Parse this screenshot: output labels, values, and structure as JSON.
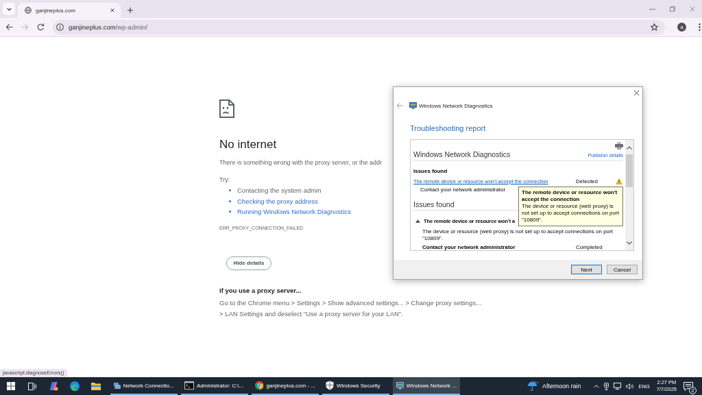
{
  "browser": {
    "tabs": [
      {
        "title": "ganjineplus.com",
        "selected": true
      }
    ],
    "nav": [
      {
        "kind": "back",
        "disabled": false
      },
      {
        "kind": "forward",
        "disabled": true
      },
      {
        "kind": "reload",
        "disabled": false
      }
    ],
    "address": {
      "host": "ganjineplus.com",
      "path": "/wp-admin/"
    },
    "profile_initial": "a"
  },
  "error_page": {
    "title": "No internet",
    "message": "There is something wrong with the proxy server, or the addr",
    "try_label": "Try:",
    "suggestions": [
      {
        "text": "Contacting the system admin",
        "kind": "text"
      },
      {
        "text": "Checking the proxy address",
        "kind": "link"
      },
      {
        "text": "Running Windows Network Diagnostics",
        "kind": "link"
      }
    ],
    "error_code": "ERR_PROXY_CONNECTION_FAILED",
    "details_button": "Hide details",
    "proxy_heading": "If you use a proxy server...",
    "proxy_help": "Go to the Chrome menu > Settings > Show advanced settings... > Change proxy settings... > LAN Settings and deselect \"Use a proxy server for your LAN\"."
  },
  "status_bubble": "javascript:diagnoseErrors()",
  "dialog": {
    "title": "Windows Network Diagnostics",
    "heading": "Troubleshooting report",
    "report": {
      "title": "Windows Network Diagnostics",
      "publisher_link": "Publisher details",
      "summary_heading": "Issues found",
      "summary": [
        {
          "issue": "The remote device or resource won't accept the connection",
          "status": "Detected",
          "action": "Contact your network administrator"
        }
      ],
      "details_heading": "Issues found",
      "details": [
        {
          "title": "The remote device or resource won't a",
          "expanded": true,
          "description": "The device or resource (web proxy) is not set up to accept connections on port \"10809\"."
        }
      ],
      "actions": [
        {
          "title": "Contact your network administrator",
          "status": "Completed"
        }
      ]
    },
    "tooltip": {
      "title": "The remote device or resource won't accept the connection",
      "text": "The device or resource (web proxy) is not set up to accept connections on port \"10809\"."
    },
    "buttons": [
      {
        "label": "Next",
        "default": true
      },
      {
        "label": "Cancel",
        "default": false
      }
    ]
  },
  "taskbar": {
    "apps": [
      {
        "kind": "network",
        "label": "Network Connectio...",
        "selected": false
      },
      {
        "kind": "terminal",
        "label": "Administrator: C:\\...",
        "selected": false
      },
      {
        "kind": "browser",
        "label": "ganjineplus.com - ...",
        "selected": false
      },
      {
        "kind": "security",
        "label": "Windows Security",
        "selected": false
      },
      {
        "kind": "diagnostics",
        "label": "Windows Network ...",
        "selected": true
      }
    ],
    "weather": "Afternoon rain",
    "language": "ENG",
    "time": "2:27 PM",
    "date": "7/7/2025",
    "notifications": "2"
  }
}
